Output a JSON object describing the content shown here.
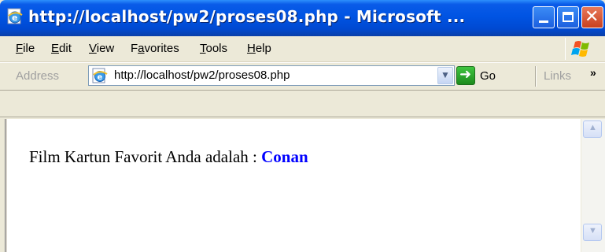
{
  "window": {
    "title": "http://localhost/pw2/proses08.php - Microsoft ...",
    "accent": "#0054e3"
  },
  "menu": {
    "items": [
      {
        "pre": "",
        "u": "F",
        "post": "ile"
      },
      {
        "pre": "",
        "u": "E",
        "post": "dit"
      },
      {
        "pre": "",
        "u": "V",
        "post": "iew"
      },
      {
        "pre": "F",
        "u": "a",
        "post": "vorites"
      },
      {
        "pre": "",
        "u": "T",
        "post": "ools"
      },
      {
        "pre": "",
        "u": "H",
        "post": "elp"
      }
    ]
  },
  "address": {
    "label": "Address",
    "url": "http://localhost/pw2/proses08.php",
    "go_label": "Go",
    "links_label": "Links",
    "more_glyph": "»"
  },
  "page": {
    "text": "Film Kartun Favorit Anda adalah : ",
    "value": "Conan",
    "value_color": "#0000ff"
  },
  "icons": [
    "ie-page-icon",
    "minimize-icon",
    "maximize-icon",
    "close-icon",
    "windows-flag-icon",
    "go-arrow-icon",
    "dropdown-arrow-icon",
    "scroll-up-icon",
    "scroll-down-icon"
  ]
}
